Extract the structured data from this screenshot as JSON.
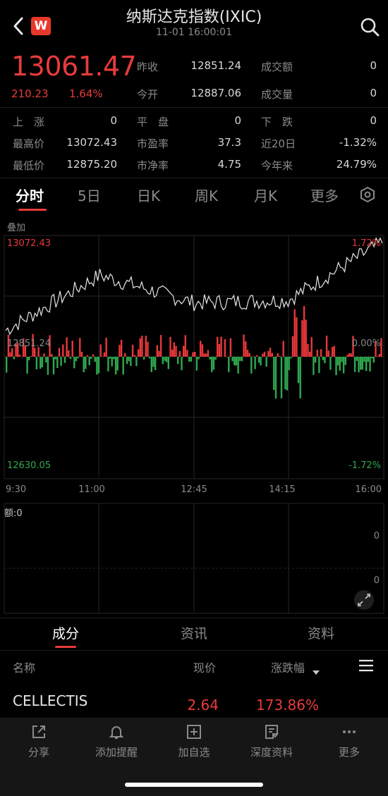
{
  "header": {
    "title": "纳斯达克指数(IXIC)",
    "datetime": "11-01 16:00:01",
    "logo_text": "W"
  },
  "price": {
    "current": "13061.47",
    "change": "210.23",
    "change_pct": "1.64%"
  },
  "stats": {
    "prev_close_label": "昨收",
    "prev_close": "12851.24",
    "turnover_label": "成交额",
    "turnover": "0",
    "open_label": "今开",
    "open": "12887.06",
    "volume_label": "成交量",
    "volume": "0",
    "up_label": "上　涨",
    "up": "0",
    "flat_label": "平　盘",
    "flat": "0",
    "down_label": "下　跌",
    "down": "0",
    "high_label": "最高价",
    "high": "13072.43",
    "pe_label": "市盈率",
    "pe": "37.3",
    "d20_label": "近20日",
    "d20": "-1.32%",
    "low_label": "最低价",
    "low": "12875.20",
    "pb_label": "市净率",
    "pb": "4.75",
    "ytd_label": "今年来",
    "ytd": "24.79%"
  },
  "tabs": [
    "分时",
    "5日",
    "日K",
    "周K",
    "月K",
    "更多"
  ],
  "chart": {
    "overlay_label": "叠加",
    "y_top_left": "13072.43",
    "y_mid_left": "12851.24",
    "y_bottom_left": "12630.05",
    "y_top_right": "1.72%",
    "y_mid_right": "0.00%",
    "y_bottom_right": "-1.72%",
    "x_labels": [
      "9:30",
      "11:00",
      "12:45",
      "14:15",
      "16:00"
    ],
    "volume_label": "额:0",
    "volume_right_top": "0",
    "volume_right_bottom": "0",
    "colors": {
      "up": "#e8383b",
      "down": "#2fa84f",
      "line": "#e6e6e6"
    }
  },
  "chart_data": {
    "type": "line",
    "x": [
      "9:30",
      "11:00",
      "12:45",
      "14:15",
      "16:00"
    ],
    "ylim": [
      12630.05,
      13072.43
    ],
    "series": [
      {
        "values": [
          12900,
          13000,
          12950,
          12955,
          13060
        ]
      }
    ]
  },
  "section_tabs": [
    "成分",
    "资讯",
    "资料"
  ],
  "table": {
    "col_name": "名称",
    "col_price": "现价",
    "col_change": "涨跌幅",
    "rows": [
      {
        "name": "CELLECTIS",
        "price": "2.64",
        "change": "173.86%"
      }
    ]
  },
  "toolbar": {
    "share": "分享",
    "alert": "添加提醒",
    "watchlist": "加自选",
    "research": "深度资料",
    "more": "更多"
  }
}
